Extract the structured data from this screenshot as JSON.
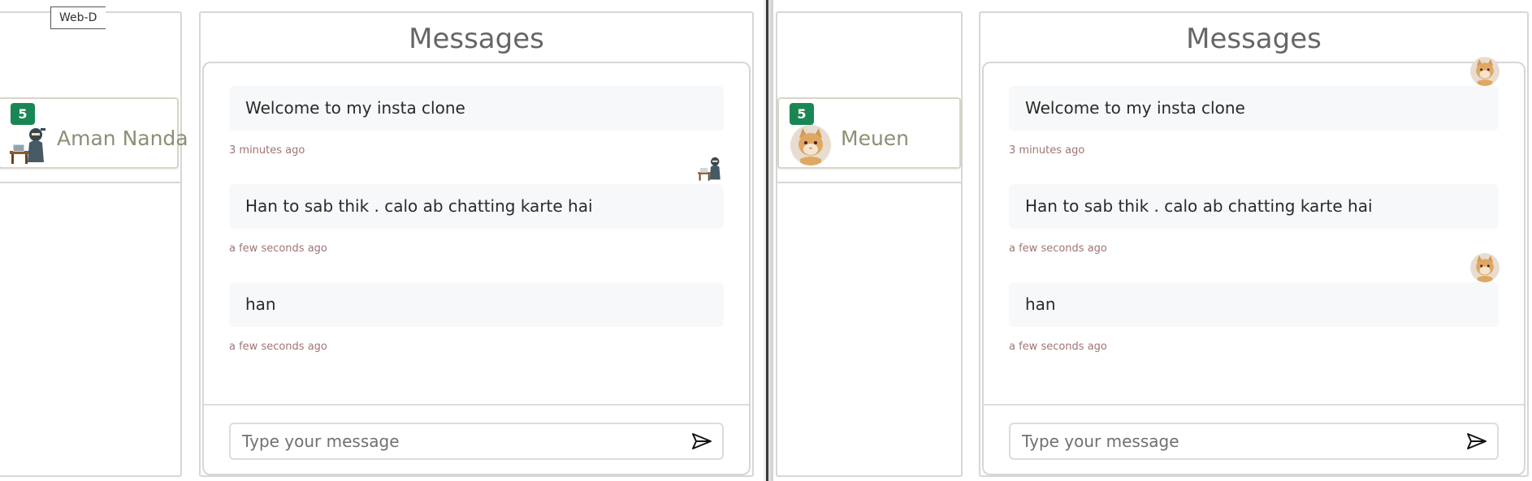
{
  "tab_label": "Web-D",
  "left_window": {
    "contact": {
      "name": "Aman Nanda",
      "badge": "5"
    },
    "chat": {
      "title": "Messages",
      "messages": [
        {
          "text": "Welcome to my insta clone",
          "time": "3 minutes ago"
        },
        {
          "text": "Han to sab thik . calo ab chatting karte hai",
          "time": "a few seconds ago"
        },
        {
          "text": "han",
          "time": "a few seconds ago"
        }
      ],
      "input_placeholder": "Type your message"
    }
  },
  "right_window": {
    "contact": {
      "name": "Meuen",
      "badge": "5"
    },
    "chat": {
      "title": "Messages",
      "messages": [
        {
          "text": "Welcome to my insta clone",
          "time": "3 minutes ago"
        },
        {
          "text": "Han to sab thik . calo ab chatting karte hai",
          "time": "a few seconds ago"
        },
        {
          "text": "han",
          "time": "a few seconds ago"
        }
      ],
      "input_placeholder": "Type your message"
    }
  },
  "colors": {
    "badge": "#198754",
    "contact_name": "#8a9074",
    "timestamp": "#a17474",
    "title": "#666666"
  }
}
